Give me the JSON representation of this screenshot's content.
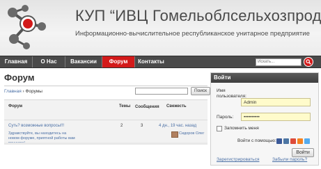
{
  "header": {
    "title": "КУП “ИВЦ Гомельоблсельхозпрода”",
    "subtitle": "Информационно-вычислительное республиканское унитарное предприятие"
  },
  "nav": {
    "items": [
      {
        "label": "Главная",
        "active": false
      },
      {
        "label": "О Нас",
        "active": false
      },
      {
        "label": "Вакансии",
        "active": false
      },
      {
        "label": "Форум",
        "active": true
      },
      {
        "label": "Контакты",
        "active": false
      }
    ],
    "search_placeholder": "Искать...",
    "search_icon": "search-icon"
  },
  "forum": {
    "title": "Форум",
    "breadcrumb": {
      "home": "Главная",
      "separator": " › ",
      "current": "Форумы"
    },
    "search_button": "Поиск",
    "columns": {
      "forum": "Форум",
      "topics": "Темы",
      "posts": "Сообщения",
      "freshness": "Свежесть"
    },
    "rows": [
      {
        "title": "Суть? возможные вопросы!!!",
        "description": "Здравствуйте, вы находитесь на новом форуме, приятной работы вам пощадке!",
        "topics": "2",
        "posts": "3",
        "freshness": "4 дн., 19 час. назад",
        "author": "Сидоров Олег"
      }
    ]
  },
  "login": {
    "heading": "Войти",
    "username_label": "Имя пользователя:",
    "username_value": "Admin",
    "password_label": "Пароль:",
    "password_value": "••••••••••",
    "remember_label": "Запомнить меня",
    "social_label": "Войти с помощью:",
    "social_colors": [
      "#3b5998",
      "#4c75a3",
      "#dd4b39",
      "#f58220",
      "#55acee"
    ],
    "submit": "Войти",
    "register_link": "Зарегистрироваться",
    "forgot_link": "Забыли пароль?"
  },
  "colors": {
    "accent": "#d31a1a",
    "nav_bg": "#4a4a4a",
    "link": "#4a6fa5",
    "input_bg": "#fffbcb"
  }
}
